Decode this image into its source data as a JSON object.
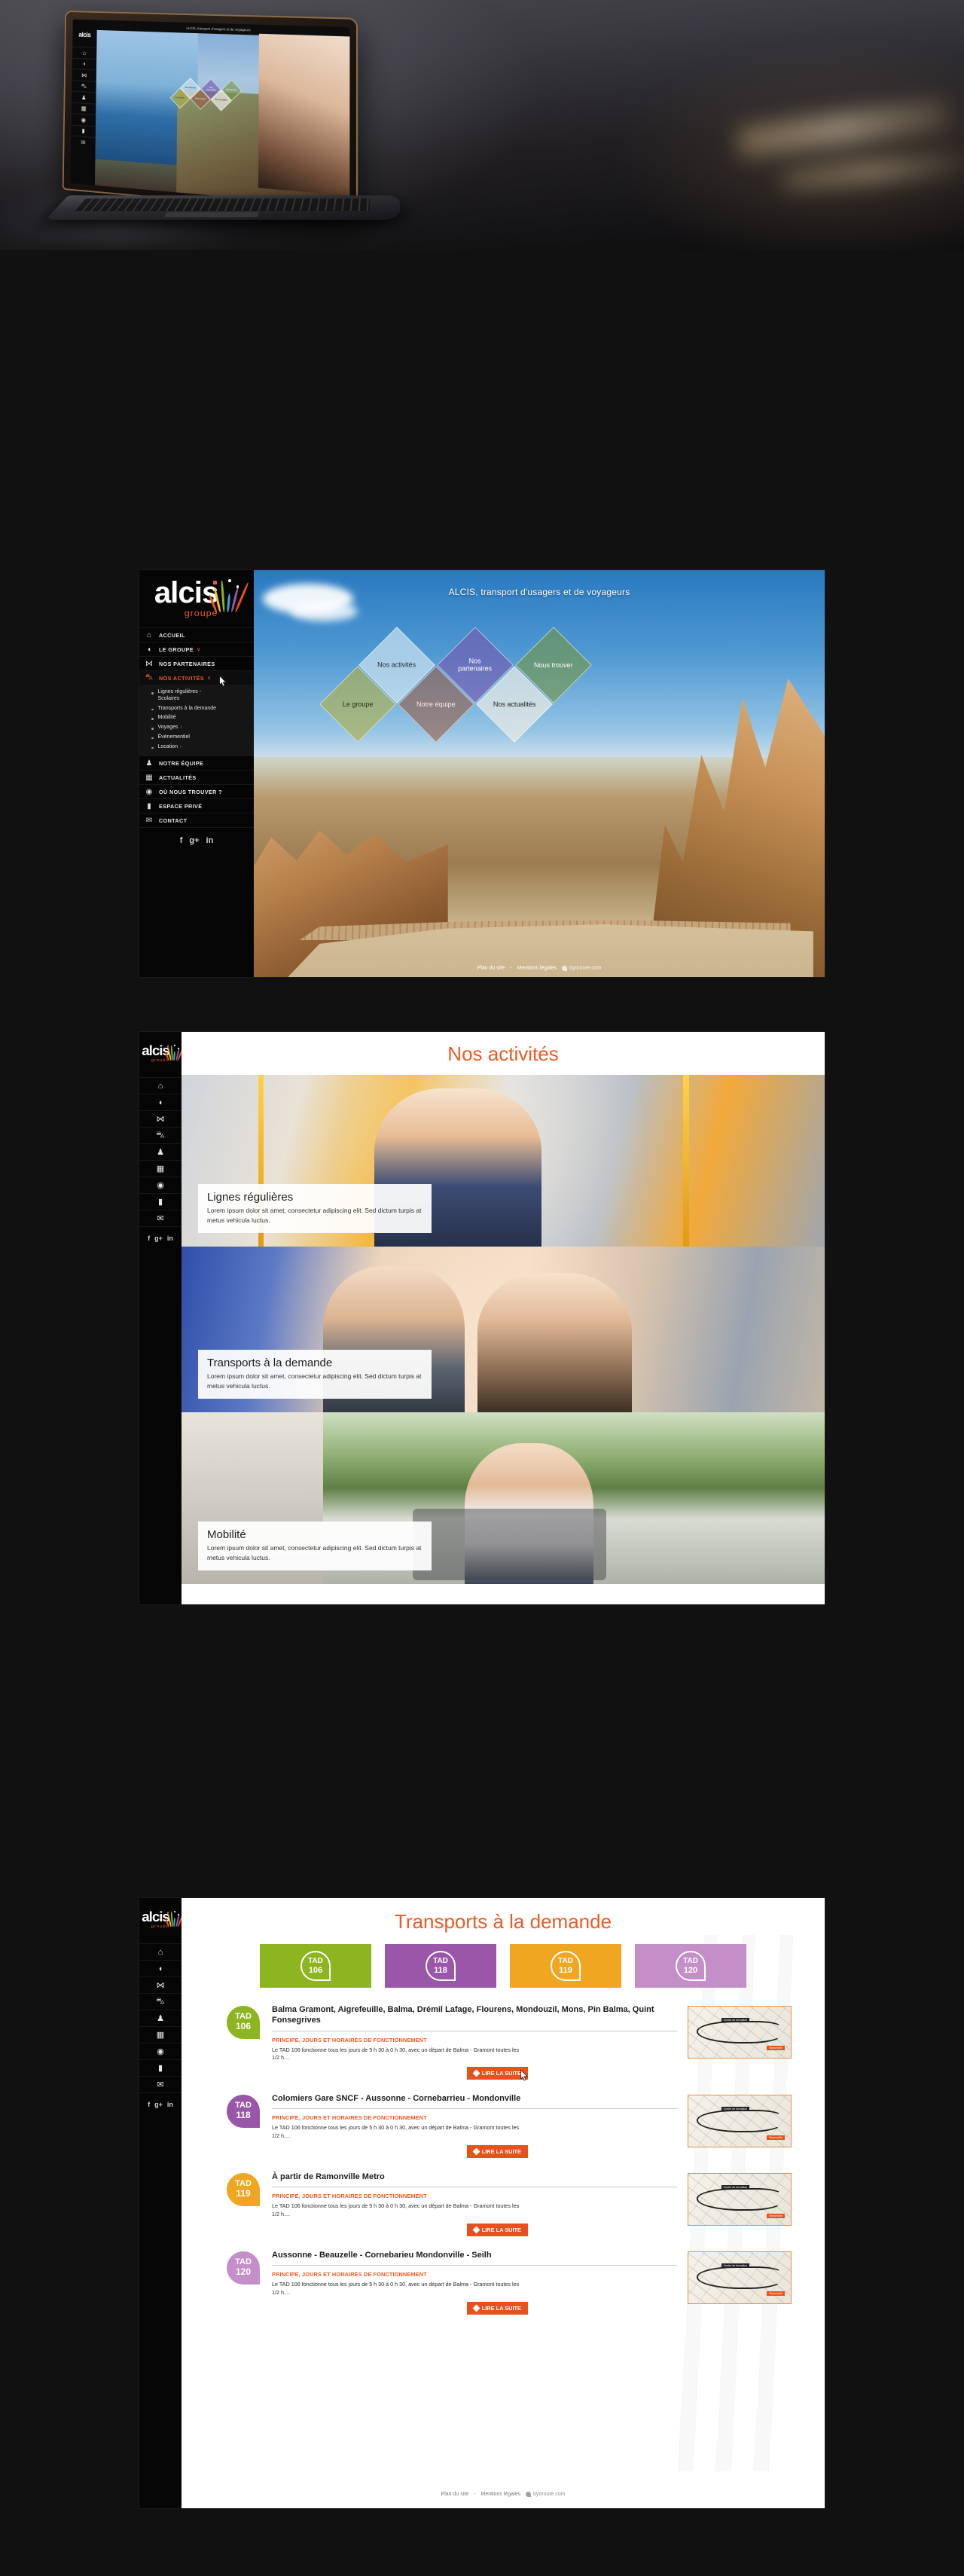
{
  "brand": {
    "name": "alcis",
    "sub": "groupe",
    "accent": "#f05a22"
  },
  "laptop": {
    "tagline": "ALCIS, transport d'usagers et de voyageurs"
  },
  "sidebar": {
    "items": [
      {
        "icon": "home-icon",
        "glyph": "⌂",
        "label": "ACCUEIL",
        "caret": "",
        "active": false
      },
      {
        "icon": "speech-bubble-icon",
        "glyph": "◖",
        "label": "LE GROUPE",
        "caret": "∨",
        "active": false
      },
      {
        "icon": "handshake-icon",
        "glyph": "⋈",
        "label": "NOS PARTENAIRES",
        "caret": "",
        "active": false
      },
      {
        "icon": "bus-icon",
        "glyph": "⛍",
        "label": "NOS ACTIVITÉS",
        "caret": "∧",
        "active": true
      },
      {
        "icon": "team-icon",
        "glyph": "♟",
        "label": "NOTRE ÉQUIPE",
        "caret": "",
        "active": false
      },
      {
        "icon": "calendar-icon",
        "glyph": "▦",
        "label": "ACTUALITÉS",
        "caret": "",
        "active": false
      },
      {
        "icon": "map-pin-icon",
        "glyph": "◉",
        "label": "OÙ NOUS TROUVER ?",
        "caret": "",
        "active": false
      },
      {
        "icon": "lock-icon",
        "glyph": "▮",
        "label": "ESPACE PRIVÉ",
        "caret": "",
        "active": false
      },
      {
        "icon": "envelope-icon",
        "glyph": "✉",
        "label": "CONTACT",
        "caret": "",
        "active": false
      }
    ],
    "submenu": [
      {
        "label": "Lignes régulières -\nScolaires",
        "arrow": ""
      },
      {
        "label": "Transports à la demande",
        "arrow": ""
      },
      {
        "label": "Mobilité",
        "arrow": ""
      },
      {
        "label": "Voyages",
        "arrow": "›"
      },
      {
        "label": "Événementiel",
        "arrow": ""
      },
      {
        "label": "Location",
        "arrow": "›"
      }
    ],
    "social": [
      {
        "name": "facebook-icon",
        "glyph": "f"
      },
      {
        "name": "google-plus-icon",
        "glyph": "g+"
      },
      {
        "name": "linkedin-icon",
        "glyph": "in"
      }
    ]
  },
  "home": {
    "tagline": "ALCIS, transport d'usagers et de voyageurs",
    "tiles": [
      {
        "label": "Le groupe",
        "color": "rgba(176,176,72,0.62)",
        "text": "#2a2a18"
      },
      {
        "label": "Nos activités",
        "color": "rgba(205,226,240,0.70)",
        "text": "#1b2a33"
      },
      {
        "label": "Notre équipe",
        "color": "rgba(150,92,70,0.60)",
        "text": "#ffe9df"
      },
      {
        "label": "Nos\npartenaires",
        "color": "rgba(116,92,176,0.66)",
        "text": "#ffffff"
      },
      {
        "label": "Nos actualités",
        "color": "rgba(236,236,230,0.72)",
        "text": "#23231c"
      },
      {
        "label": "Nous trouver",
        "color": "rgba(116,150,70,0.62)",
        "text": "#ffffff"
      }
    ],
    "footer": {
      "sitemap": "Plan du site",
      "sep": "-",
      "legal": "Mentions légales",
      "agency": "byoroute.com"
    }
  },
  "activites": {
    "title": "Nos activités",
    "cards": [
      {
        "title": "Lignes régulières",
        "text": "Lorem ipsum dolor sit amet, consectetur adipiscing elit. Sed dictum turpis at metus vehicula luctus."
      },
      {
        "title": "Transports à la demande",
        "text": "Lorem ipsum dolor sit amet, consectetur adipiscing elit. Sed dictum turpis at metus vehicula luctus."
      },
      {
        "title": "Mobilité",
        "text": "Lorem ipsum dolor sit amet, consectetur adipiscing elit. Sed dictum turpis at metus vehicula luctus."
      }
    ]
  },
  "tad": {
    "title": "Transports à la demande",
    "tiles": [
      {
        "code": "TAD",
        "num": "106",
        "color": "#8cb520"
      },
      {
        "code": "TAD",
        "num": "118",
        "color": "#9a56a8"
      },
      {
        "code": "TAD",
        "num": "119",
        "color": "#f0a621"
      },
      {
        "code": "TAD",
        "num": "120",
        "color": "#c48fc8"
      }
    ],
    "subhead": "PRINCIPE, JOURS ET HORAIRES DE FONCTIONNEMENT",
    "button": "LIRE LA SUITE",
    "rows": [
      {
        "code": "TAD",
        "num": "106",
        "color": "#8cb520",
        "title": "Balma Gramont, Aigrefeuille, Balma, Drémil Lafage, Flourens, Mondouzil, Mons, Pin Balma, Quint Fonsegrives",
        "text": "Le TAD 106 fonctionne tous les jours de 5 h 30 à 0 h 30, avec un départ de Balma - Gramont toutes les 1/2 h...."
      },
      {
        "code": "TAD",
        "num": "118",
        "color": "#9a56a8",
        "title": "Colomiers Gare SNCF - Aussonne - Cornebarrieu - Mondonville",
        "text": "Le TAD 106 fonctionne tous les jours de 5 h 30 à 0 h 30, avec un départ de Balma - Gramont toutes les 1/2 h...."
      },
      {
        "code": "TAD",
        "num": "119",
        "color": "#f0a621",
        "title": "À partir de Ramonville Metro",
        "text": "Le TAD 106 fonctionne tous les jours de 5 h 30 à 0 h 30, avec un départ de Balma - Gramont toutes les 1/2 h...."
      },
      {
        "code": "TAD",
        "num": "120",
        "color": "#c48fc8",
        "title": "Aussonne - Beauzelle - Cornebarieu Mondonville - Seilh",
        "text": "Le TAD 106 fonctionne tous les jours de 5 h 30 à 0 h 30, avec un départ de Balma - Gramont toutes les 1/2 h...."
      }
    ],
    "map": {
      "tag1": "Centre de formation",
      "tag2": "Ramonville"
    },
    "footer": {
      "sitemap": "Plan du site",
      "sep": "-",
      "legal": "Mentions légales",
      "agency": "byoroute.com"
    }
  }
}
